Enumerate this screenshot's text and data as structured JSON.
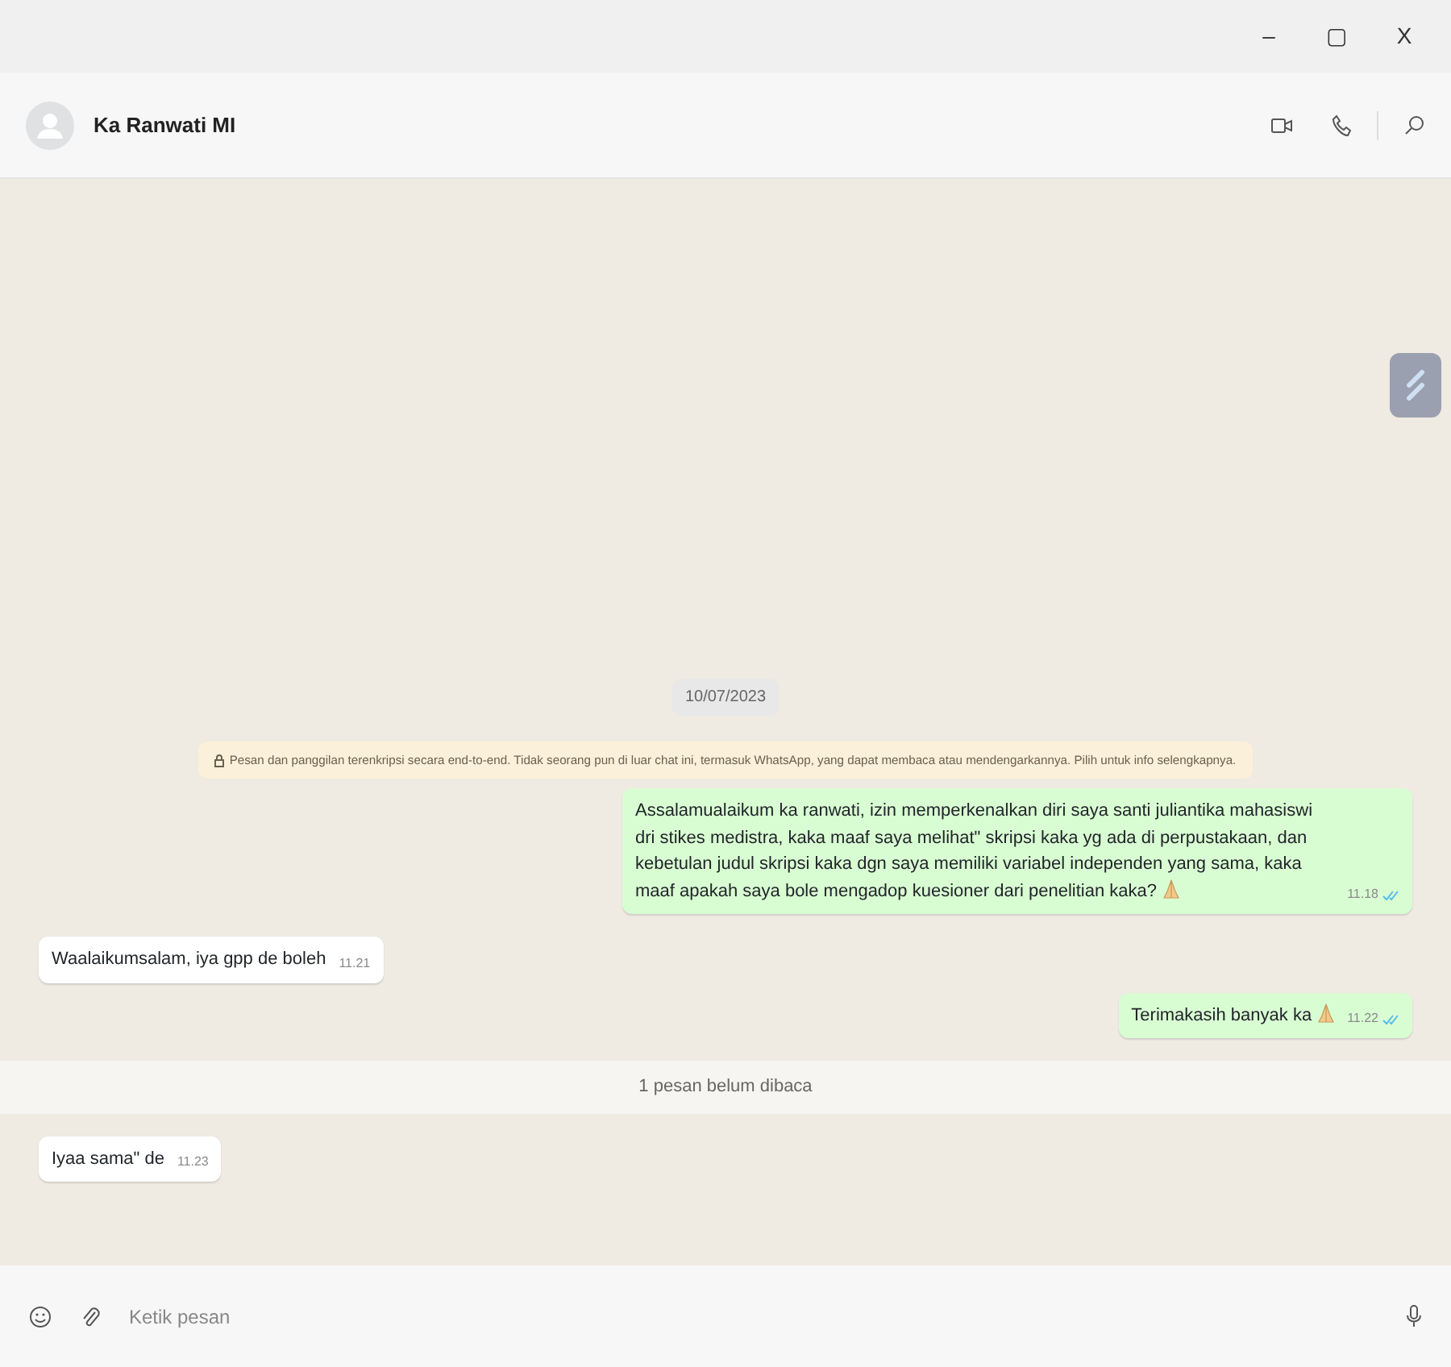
{
  "window": {
    "controls": [
      "–",
      "▢",
      "X"
    ]
  },
  "header": {
    "contact_name": "Ka Ranwati MI"
  },
  "chat": {
    "date": "10/07/2023",
    "encryption_notice": "Pesan dan panggilan terenkripsi secara end-to-end. Tidak seorang pun di luar chat ini, termasuk WhatsApp, yang dapat membaca atau mendengarkannya. Pilih untuk info selengkapnya.",
    "messages": [
      {
        "kind": "out",
        "text": "Assalamualaikum ka ranwati, izin memperkenalkan diri saya santi juliantika mahasiswi dri stikes medistra, kaka maaf saya melihat\" skripsi kaka yg ada di perpustakaan, dan kebetulan judul skripsi kaka dgn saya memiliki variabel independen yang sama, kaka maaf apakah saya bole mengadop kuesioner dari penelitian kaka?",
        "emoji": true,
        "time": "11.18",
        "read": true
      },
      {
        "kind": "in",
        "text": "Waalaikumsalam, iya gpp de boleh",
        "time": "11.21"
      },
      {
        "kind": "out",
        "text": "Terimakasih banyak ka",
        "emoji": true,
        "time": "11.22",
        "read": true
      },
      {
        "kind": "divider",
        "text": "1 pesan belum dibaca"
      },
      {
        "kind": "in",
        "text": "Iyaa sama\" de",
        "time": "11.23"
      }
    ]
  },
  "composer": {
    "placeholder": "Ketik pesan"
  }
}
